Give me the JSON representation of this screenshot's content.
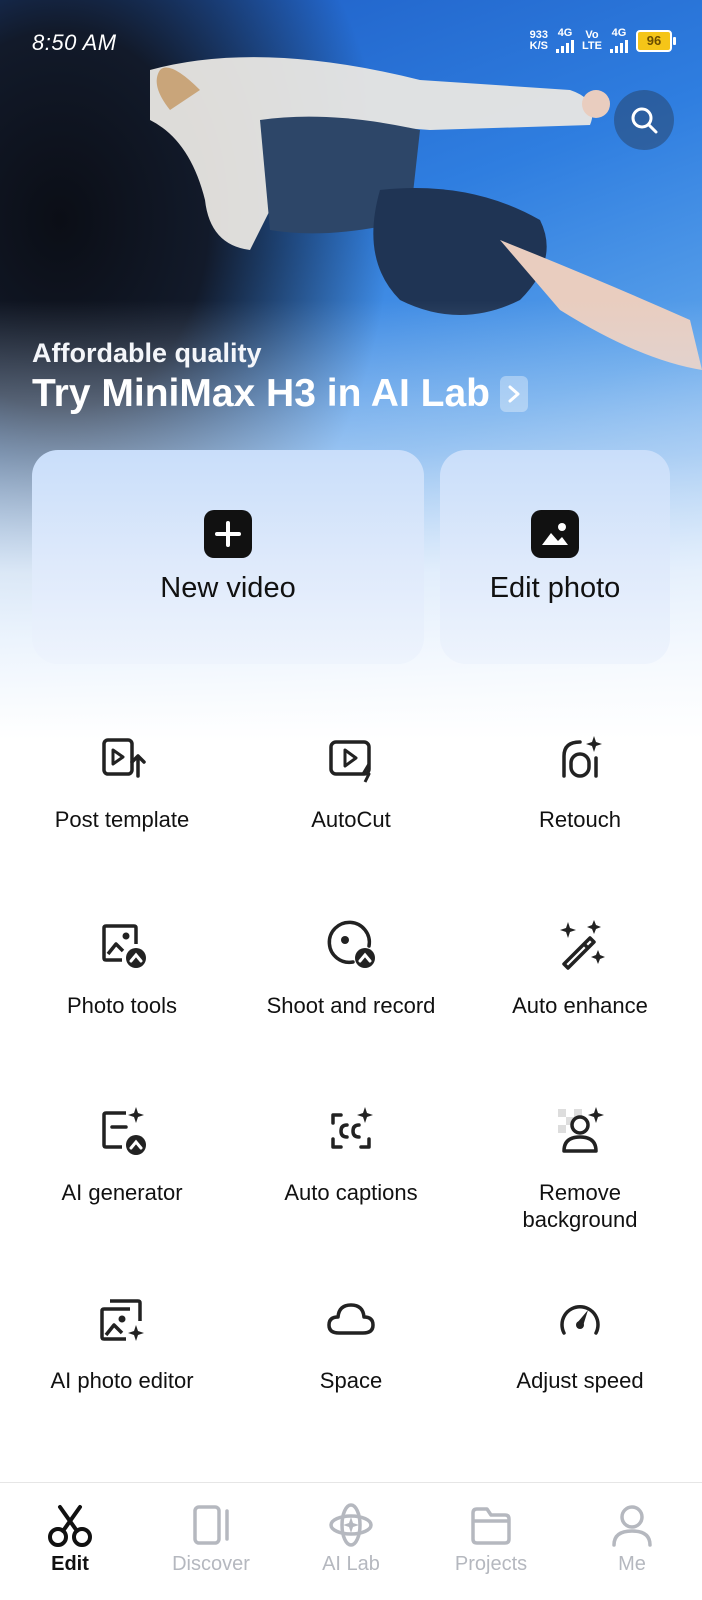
{
  "status_bar": {
    "time": "8:50 AM",
    "net_speed_value": "933",
    "net_speed_unit": "K/S",
    "sim1_label": "4G",
    "volte_top": "Vo",
    "volte_bottom": "LTE",
    "sim2_label": "4G",
    "battery": "96",
    "battery_color": "#f5c518"
  },
  "hero": {
    "subtitle": "Affordable quality",
    "title": "Try MiniMax H3 in AI Lab",
    "search_icon": "search-icon",
    "arrow_icon": "chevron-right-icon"
  },
  "cards": {
    "new_video": {
      "label": "New video",
      "icon": "plus-square-icon"
    },
    "edit_photo": {
      "label": "Edit photo",
      "icon": "image-icon"
    }
  },
  "tools": [
    {
      "label": "Post template",
      "icon": "post-template-icon"
    },
    {
      "label": "AutoCut",
      "icon": "autocut-icon"
    },
    {
      "label": "Retouch",
      "icon": "retouch-icon"
    },
    {
      "label": "Photo tools",
      "icon": "photo-tools-icon"
    },
    {
      "label": "Shoot and record",
      "icon": "shoot-record-icon"
    },
    {
      "label": "Auto enhance",
      "icon": "magic-wand-icon"
    },
    {
      "label": "AI generator",
      "icon": "ai-generator-icon"
    },
    {
      "label": "Auto captions",
      "icon": "captions-icon"
    },
    {
      "label": "Remove background",
      "icon": "remove-background-icon"
    },
    {
      "label": "AI photo editor",
      "icon": "ai-photo-editor-icon"
    },
    {
      "label": "Space",
      "icon": "cloud-icon"
    },
    {
      "label": "Adjust speed",
      "icon": "speedometer-icon"
    }
  ],
  "bottom_nav": {
    "active": "Edit",
    "active_color": "#111111",
    "inactive_color": "#b5b8bf",
    "items": [
      {
        "label": "Edit",
        "icon": "scissors-icon"
      },
      {
        "label": "Discover",
        "icon": "discover-icon"
      },
      {
        "label": "AI Lab",
        "icon": "ai-lab-icon"
      },
      {
        "label": "Projects",
        "icon": "folder-icon"
      },
      {
        "label": "Me",
        "icon": "person-icon"
      }
    ]
  }
}
